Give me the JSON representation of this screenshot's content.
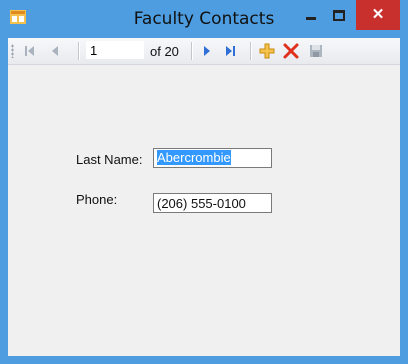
{
  "window": {
    "title": "Faculty Contacts",
    "close_glyph": "✕",
    "accent": "#4d9de0",
    "close_color": "#c7302c"
  },
  "toolbar": {
    "position_value": "1",
    "count_label": "of 20",
    "icons": [
      "move-first-icon",
      "move-previous-icon",
      "move-next-icon",
      "move-last-icon",
      "add-new-icon",
      "delete-icon",
      "save-icon"
    ]
  },
  "form": {
    "last_name_label": "Last Name:",
    "last_name_value": "Abercrombie",
    "phone_label": "Phone:",
    "phone_value": "(206) 555-0100"
  }
}
